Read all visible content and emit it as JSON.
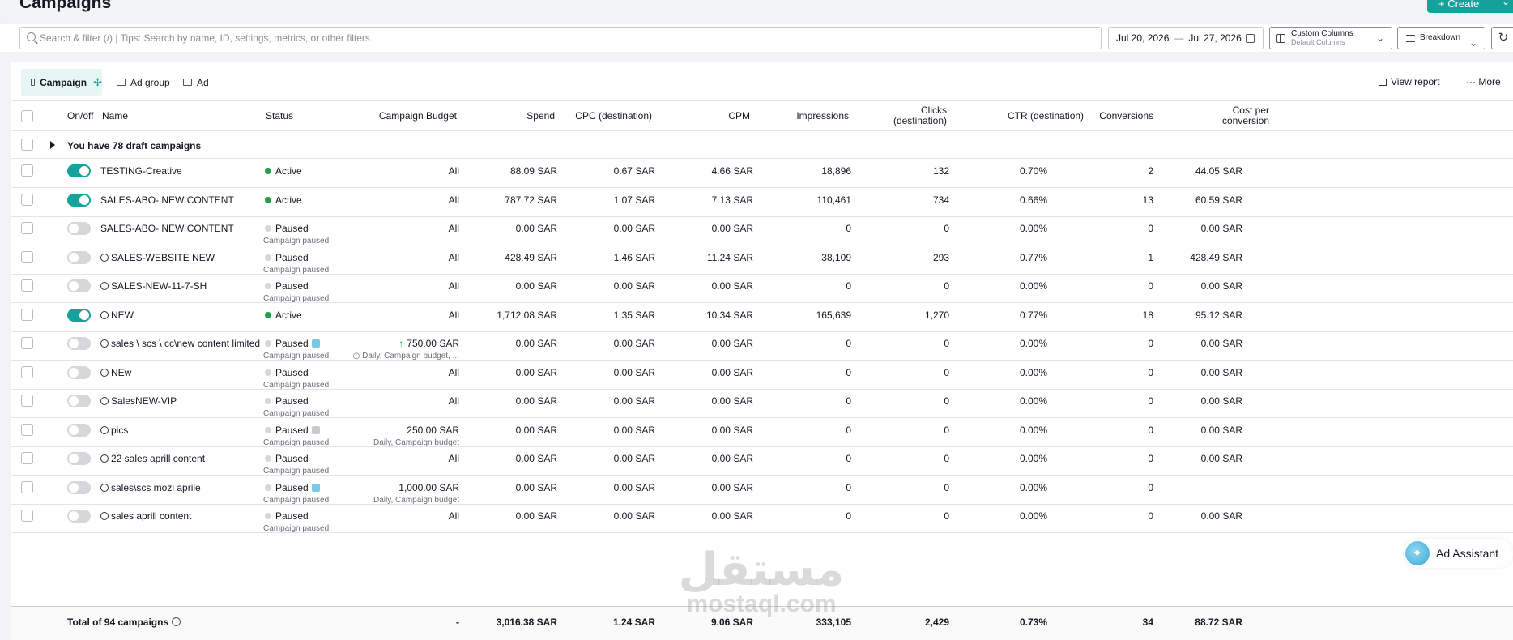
{
  "page": {
    "title": "Campaigns",
    "create_label": "+ Create"
  },
  "toolbar": {
    "search_placeholder": "Search & filter (/) | Tips: Search by name, ID, settings, metrics, or other filters",
    "date_start": "Jul 20, 2026",
    "date_end": "Jul 27, 2026",
    "columns_title": "Custom Columns",
    "columns_sub": "Default Columns",
    "breakdown_label": "Breakdown"
  },
  "tabs": [
    {
      "label": "Campaign"
    },
    {
      "label": "Ad group"
    },
    {
      "label": "Ad"
    }
  ],
  "actions": {
    "view_report": "View report",
    "more": "More"
  },
  "columns": {
    "onoff": "On/off",
    "name": "Name",
    "status": "Status",
    "budget": "Campaign Budget",
    "spend": "Spend",
    "cpc": "CPC (destination)",
    "cpm": "CPM",
    "impressions": "Impressions",
    "clicks_1": "Clicks",
    "clicks_2": "(destination)",
    "ctr": "CTR (destination)",
    "conversions": "Conversions",
    "cpc_conv_1": "Cost per",
    "cpc_conv_2": "conversion"
  },
  "draft_text": "You have 78 draft campaigns",
  "rows": [
    {
      "on": true,
      "icon": false,
      "name": "TESTING-Creative",
      "status": "Active",
      "status_type": "active",
      "status_sub": "",
      "shield": "",
      "budget": "All",
      "budget_arrow": false,
      "budget_sub": "",
      "spend": "88.09 SAR",
      "cpc": "0.67 SAR",
      "cpm": "4.66 SAR",
      "impressions": "18,896",
      "clicks": "132",
      "ctr": "0.70%",
      "conversions": "2",
      "cost_conv": "44.05 SAR"
    },
    {
      "on": true,
      "icon": false,
      "name": "SALES-ABO- NEW CONTENT",
      "status": "Active",
      "status_type": "active",
      "status_sub": "",
      "shield": "",
      "budget": "All",
      "budget_arrow": false,
      "budget_sub": "",
      "spend": "787.72 SAR",
      "cpc": "1.07 SAR",
      "cpm": "7.13 SAR",
      "impressions": "110,461",
      "clicks": "734",
      "ctr": "0.66%",
      "conversions": "13",
      "cost_conv": "60.59 SAR"
    },
    {
      "on": false,
      "icon": false,
      "name": "SALES-ABO- NEW CONTENT",
      "status": "Paused",
      "status_type": "paused",
      "status_sub": "Campaign paused",
      "shield": "",
      "budget": "All",
      "budget_arrow": false,
      "budget_sub": "",
      "spend": "0.00 SAR",
      "cpc": "0.00 SAR",
      "cpm": "0.00 SAR",
      "impressions": "0",
      "clicks": "0",
      "ctr": "0.00%",
      "conversions": "0",
      "cost_conv": "0.00 SAR"
    },
    {
      "on": false,
      "icon": true,
      "name": "SALES-WEBSITE NEW",
      "status": "Paused",
      "status_type": "paused",
      "status_sub": "Campaign paused",
      "shield": "",
      "budget": "All",
      "budget_arrow": false,
      "budget_sub": "",
      "spend": "428.49 SAR",
      "cpc": "1.46 SAR",
      "cpm": "11.24 SAR",
      "impressions": "38,109",
      "clicks": "293",
      "ctr": "0.77%",
      "conversions": "1",
      "cost_conv": "428.49 SAR"
    },
    {
      "on": false,
      "icon": true,
      "name": "SALES-NEW-11-7-SH",
      "status": "Paused",
      "status_type": "paused",
      "status_sub": "Campaign paused",
      "shield": "",
      "budget": "All",
      "budget_arrow": false,
      "budget_sub": "",
      "spend": "0.00 SAR",
      "cpc": "0.00 SAR",
      "cpm": "0.00 SAR",
      "impressions": "0",
      "clicks": "0",
      "ctr": "0.00%",
      "conversions": "0",
      "cost_conv": "0.00 SAR"
    },
    {
      "on": true,
      "icon": true,
      "name": "NEW",
      "status": "Active",
      "status_type": "active",
      "status_sub": "",
      "shield": "",
      "budget": "All",
      "budget_arrow": false,
      "budget_sub": "",
      "spend": "1,712.08 SAR",
      "cpc": "1.35 SAR",
      "cpm": "10.34 SAR",
      "impressions": "165,639",
      "clicks": "1,270",
      "ctr": "0.77%",
      "conversions": "18",
      "cost_conv": "95.12 SAR"
    },
    {
      "on": false,
      "icon": true,
      "name": "sales \\ scs \\ cc\\new content limited",
      "status": "Paused",
      "status_type": "paused",
      "status_sub": "Campaign paused",
      "shield": "#7cc6e6",
      "budget": "750.00 SAR",
      "budget_arrow": true,
      "budget_sub": "Daily, Campaign budget, ...",
      "spend": "0.00 SAR",
      "cpc": "0.00 SAR",
      "cpm": "0.00 SAR",
      "impressions": "0",
      "clicks": "0",
      "ctr": "0.00%",
      "conversions": "0",
      "cost_conv": "0.00 SAR"
    },
    {
      "on": false,
      "icon": true,
      "name": "NEw",
      "status": "Paused",
      "status_type": "paused",
      "status_sub": "Campaign paused",
      "shield": "",
      "budget": "All",
      "budget_arrow": false,
      "budget_sub": "",
      "spend": "0.00 SAR",
      "cpc": "0.00 SAR",
      "cpm": "0.00 SAR",
      "impressions": "0",
      "clicks": "0",
      "ctr": "0.00%",
      "conversions": "0",
      "cost_conv": "0.00 SAR"
    },
    {
      "on": false,
      "icon": true,
      "name": "SalesNEW-VIP",
      "status": "Paused",
      "status_type": "paused",
      "status_sub": "Campaign paused",
      "shield": "",
      "budget": "All",
      "budget_arrow": false,
      "budget_sub": "",
      "spend": "0.00 SAR",
      "cpc": "0.00 SAR",
      "cpm": "0.00 SAR",
      "impressions": "0",
      "clicks": "0",
      "ctr": "0.00%",
      "conversions": "0",
      "cost_conv": "0.00 SAR"
    },
    {
      "on": false,
      "icon": true,
      "name": "pics",
      "status": "Paused",
      "status_type": "paused",
      "status_sub": "Campaign paused",
      "shield": "#c9cbd1",
      "budget": "250.00 SAR",
      "budget_arrow": false,
      "budget_sub": "Daily, Campaign budget",
      "spend": "0.00 SAR",
      "cpc": "0.00 SAR",
      "cpm": "0.00 SAR",
      "impressions": "0",
      "clicks": "0",
      "ctr": "0.00%",
      "conversions": "0",
      "cost_conv": "0.00 SAR"
    },
    {
      "on": false,
      "icon": true,
      "name": "22 sales aprill content",
      "status": "Paused",
      "status_type": "paused",
      "status_sub": "Campaign paused",
      "shield": "",
      "budget": "All",
      "budget_arrow": false,
      "budget_sub": "",
      "spend": "0.00 SAR",
      "cpc": "0.00 SAR",
      "cpm": "0.00 SAR",
      "impressions": "0",
      "clicks": "0",
      "ctr": "0.00%",
      "conversions": "0",
      "cost_conv": "0.00 SAR"
    },
    {
      "on": false,
      "icon": true,
      "name": "sales\\scs mozi aprile",
      "status": "Paused",
      "status_type": "paused",
      "status_sub": "Campaign paused",
      "shield": "#7cc6e6",
      "budget": "1,000.00 SAR",
      "budget_arrow": false,
      "budget_sub": "Daily, Campaign budget",
      "spend": "0.00 SAR",
      "cpc": "0.00 SAR",
      "cpm": "0.00 SAR",
      "impressions": "0",
      "clicks": "0",
      "ctr": "0.00%",
      "conversions": "0",
      "cost_conv": ""
    },
    {
      "on": false,
      "icon": true,
      "name": "sales aprill content",
      "status": "Paused",
      "status_type": "paused",
      "status_sub": "Campaign paused",
      "shield": "",
      "budget": "All",
      "budget_arrow": false,
      "budget_sub": "",
      "spend": "0.00 SAR",
      "cpc": "0.00 SAR",
      "cpm": "0.00 SAR",
      "impressions": "0",
      "clicks": "0",
      "ctr": "0.00%",
      "conversions": "0",
      "cost_conv": "0.00 SAR"
    }
  ],
  "total": {
    "label": "Total of 94 campaigns",
    "budget": "-",
    "spend": "3,016.38 SAR",
    "cpc": "1.24 SAR",
    "cpm": "9.06 SAR",
    "impressions": "333,105",
    "clicks": "2,429",
    "ctr": "0.73%",
    "conversions": "34",
    "cost_conv": "88.72 SAR"
  },
  "watermark": {
    "arabic": "مستقل",
    "latin": "mostaql.com"
  },
  "assistant_label": "Ad Assistant",
  "colors": {
    "accent": "#13a39a",
    "active": "#25a049",
    "paused": "#d6d7db"
  }
}
